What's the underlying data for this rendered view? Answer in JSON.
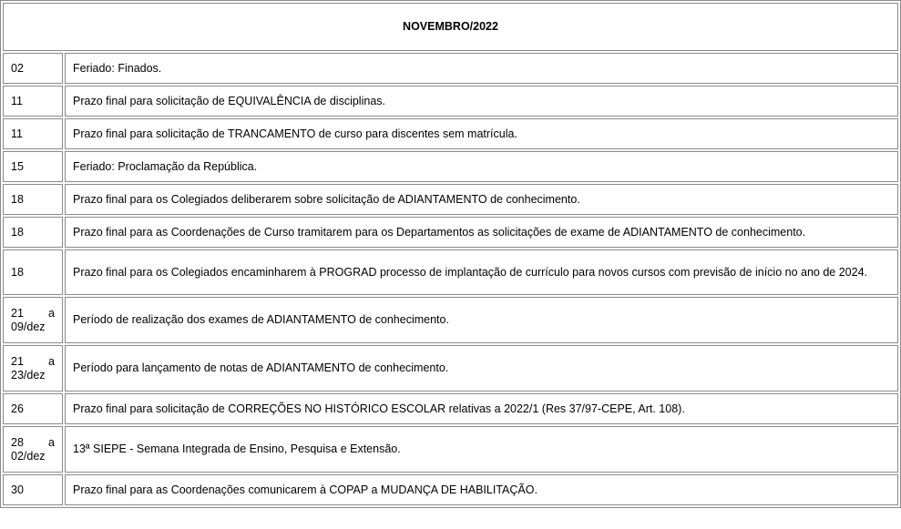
{
  "calendar": {
    "month_title": "NOVEMBRO/2022",
    "rows": [
      {
        "date": "02",
        "text": "Feriado: Finados."
      },
      {
        "date": "11",
        "text": "Prazo final para solicitação de EQUIVALÊNCIA de disciplinas."
      },
      {
        "date": "11",
        "text": "Prazo final para solicitação de TRANCAMENTO de curso para discentes sem matrícula."
      },
      {
        "date": "15",
        "text": "Feriado: Proclamação da República."
      },
      {
        "date": "18",
        "text": "Prazo final para os Colegiados deliberarem sobre solicitação de ADIANTAMENTO de conhecimento."
      },
      {
        "date": "18",
        "text": "Prazo final para as Coordenações de Curso tramitarem para os Departamentos as solicitações de exame de ADIANTAMENTO de conhecimento."
      },
      {
        "date": "18",
        "text": "Prazo final para os Colegiados encaminharem à PROGRAD processo de implantação de currículo para novos cursos com previsão de início no ano de 2024."
      },
      {
        "date": "21 a 09/dez",
        "text": "Período de realização dos exames de ADIANTAMENTO de conhecimento."
      },
      {
        "date": "21 a 23/dez",
        "text": "Período para lançamento de notas de ADIANTAMENTO de conhecimento."
      },
      {
        "date": "26",
        "text": "Prazo final para solicitação de CORREÇÕES NO HISTÓRICO ESCOLAR relativas a 2022/1 (Res 37/97-CEPE, Art. 108)."
      },
      {
        "date": "28 a 02/dez",
        "text": "13ª SIEPE - Semana Integrada de Ensino, Pesquisa e Extensão."
      },
      {
        "date": "30",
        "text": "Prazo final para as Coordenações comunicarem à COPAP a MUDANÇA DE HABILITAÇÃO."
      }
    ]
  }
}
